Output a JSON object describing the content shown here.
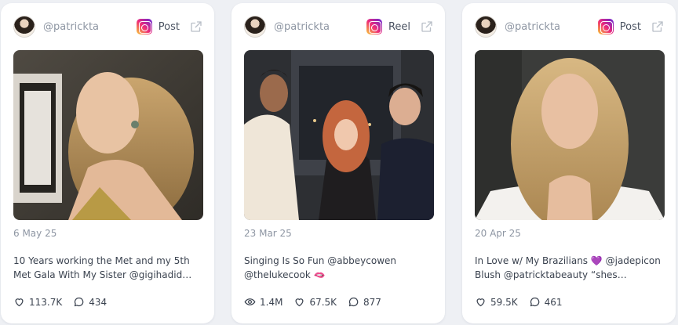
{
  "cards": [
    {
      "handle": "@patrickta",
      "post_type": "Post",
      "date": "6 May 25",
      "caption": "10 Years working the Met and my 5th Met Gala With My Sister @gigihadid wearing...",
      "stats": {
        "likes": "113.7K",
        "comments": "434"
      }
    },
    {
      "handle": "@patrickta",
      "post_type": "Reel",
      "date": "23 Mar 25",
      "caption": "Singing Is So Fun @abbeycowen @thelukecook 🫦",
      "stats": {
        "views": "1.4M",
        "likes": "67.5K",
        "comments": "877"
      }
    },
    {
      "handle": "@patrickta",
      "post_type": "Post",
      "date": "20 Apr 25",
      "caption": "In Love w/ My Brazilians 💜 @jadepicon Blush @patricktabeauty “shes Seductive…",
      "stats": {
        "likes": "59.5K",
        "comments": "461"
      }
    }
  ],
  "icons": {
    "platform": "instagram-icon",
    "external": "external-link-icon",
    "likes": "heart-icon",
    "comments": "comment-icon",
    "views": "eye-icon"
  },
  "colors": {
    "background": "#eef0f4",
    "card": "#ffffff",
    "muted_text": "#8e96a3",
    "body_text": "#3b4350"
  }
}
